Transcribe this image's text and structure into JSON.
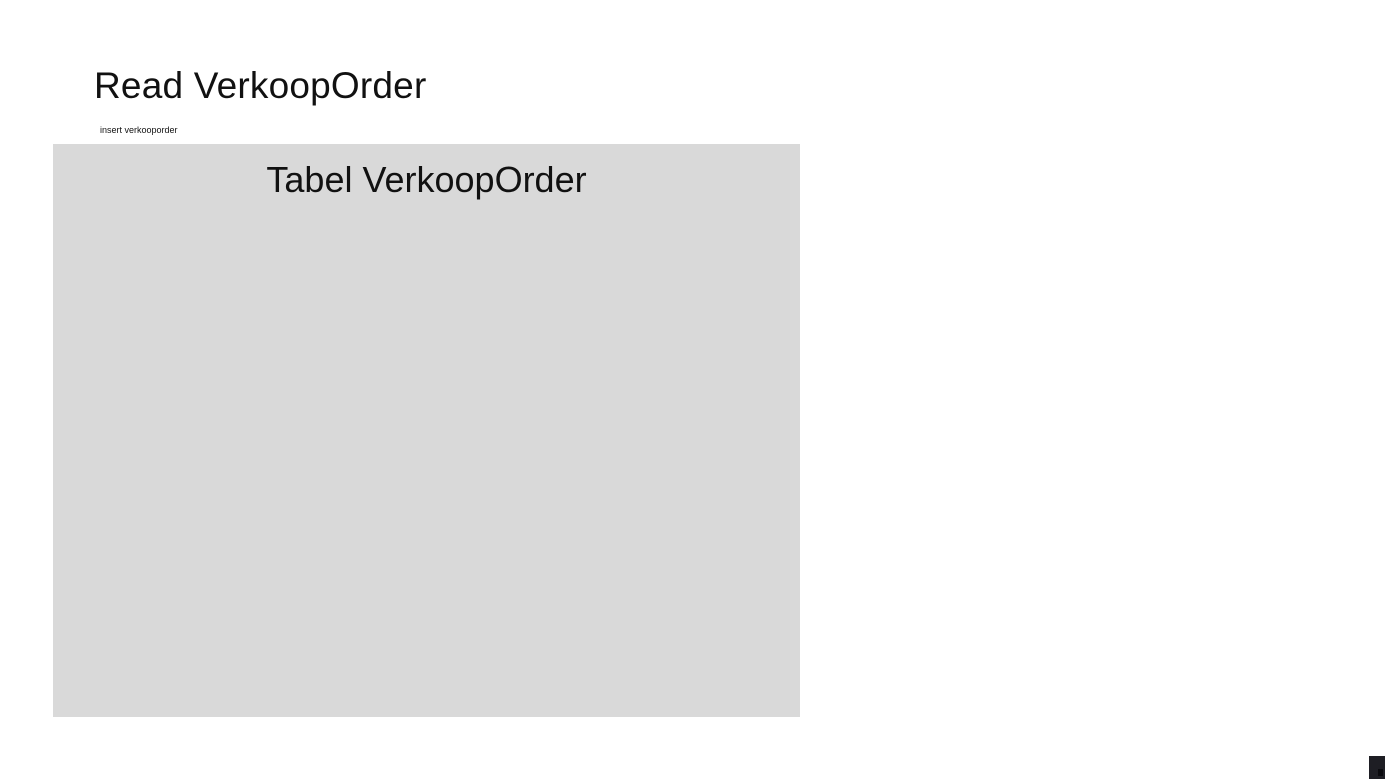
{
  "header": {
    "title": "Read VerkoopOrder"
  },
  "actions": {
    "insert_label": "insert verkooporder"
  },
  "table_panel": {
    "title": "Tabel VerkoopOrder",
    "background_color": "#d9d9d9"
  },
  "corner_widget": {
    "icon": "panel-toggle-icon"
  }
}
